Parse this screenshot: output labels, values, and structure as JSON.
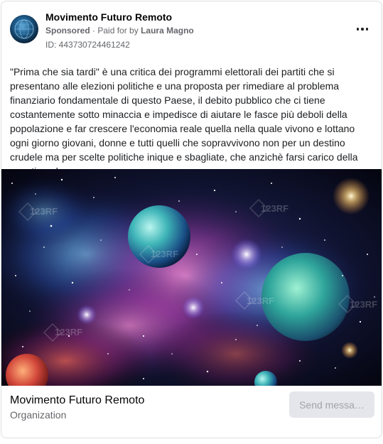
{
  "post": {
    "page_name": "Movimento Futuro Remoto",
    "sponsored_label": "Sponsored",
    "separator": " · ",
    "paid_for_label": "Paid for by",
    "paid_for_name": "Laura Magno",
    "ad_id": "ID: 443730724461242",
    "body_text": "\"Prima che sia tardi\" è una critica dei programmi elettorali dei partiti che si presentano alle elezioni politiche e una proposta per rimediare al problema finanziario fondamentale di questo Paese, il debito pubblico che ci tiene costantemente sotto minaccia e impedisce di aiutare le fasce più deboli della popolazione e far crescere l'economia reale quella nella quale vivono e lottano ogni giorno giovani, donne e tutti quelli che sopravvivono non per un destino crudele ma per scelte politiche inique e sbagliate, che anzichè farsi carico della questione la…",
    "more_icon": "more-horizontal-icon"
  },
  "creative": {
    "description_icon": "space-nebula-image",
    "watermark": "123RF"
  },
  "footer": {
    "title": "Movimento Futuro Remoto",
    "subtitle": "Organization",
    "cta_label": "Send messa…"
  },
  "colors": {
    "text_primary": "#050505",
    "text_secondary": "#65676b",
    "cta_bg": "#e4e6eb",
    "cta_text": "#a0a3a8"
  }
}
